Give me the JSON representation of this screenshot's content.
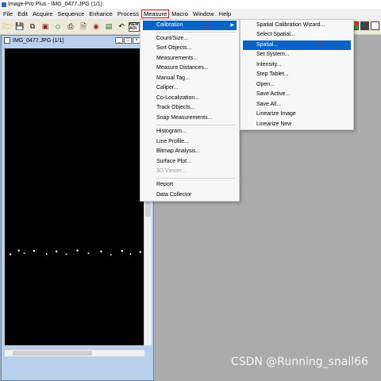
{
  "window": {
    "title": "Image-Pro Plus - IMG_0477.JPG (1/1)"
  },
  "menubar": {
    "items": [
      "File",
      "Edit",
      "Acquire",
      "Sequence",
      "Enhance",
      "Process",
      "Measure",
      "Macro",
      "Window",
      "Help"
    ],
    "active": "Measure"
  },
  "toolbar": {
    "icons": [
      "open-folder-icon",
      "save-icon",
      "copy-icon",
      "stamp-icon",
      "lasso-icon",
      "print-icon",
      "preview-icon",
      "color-icon",
      "image-icon",
      "undo-icon",
      "new-aoi-icon",
      "mesh-icon"
    ],
    "new_aoi_label": "NEW AOI"
  },
  "document": {
    "title": "IMG_0477.JPG (1/1)"
  },
  "measure_menu": {
    "items": [
      {
        "label": "Calibration",
        "highlighted": true,
        "submenu": true
      },
      {
        "label": "Count/Size..."
      },
      {
        "label": "Sort Objects..."
      },
      {
        "label": "Measurements..."
      },
      {
        "label": "Measure Distances..."
      },
      {
        "label": "Manual Tag..."
      },
      {
        "label": "Caliper..."
      },
      {
        "label": "Co-Localization..."
      },
      {
        "label": "Track Objects..."
      },
      {
        "label": "Snap Measurements..."
      },
      {
        "label": "Histogram..."
      },
      {
        "label": "Line Profile..."
      },
      {
        "label": "Bitmap Analysis..."
      },
      {
        "label": "Surface Plot..."
      },
      {
        "label": "3D Viewer...",
        "disabled": true
      },
      {
        "label": "Report"
      },
      {
        "label": "Data Collector"
      }
    ]
  },
  "calibration_submenu": {
    "items": [
      {
        "label": "Spatial Calibration Wizard..."
      },
      {
        "label": "Select Spatial..."
      },
      {
        "label": "Spatial...",
        "highlighted": true
      },
      {
        "label": "Set System..."
      },
      {
        "label": "Intensity..."
      },
      {
        "label": "Step Tablet..."
      },
      {
        "label": "Open..."
      },
      {
        "label": "Save Active..."
      },
      {
        "label": "Save All..."
      },
      {
        "label": "Linearize Image"
      },
      {
        "label": "Linearize New"
      }
    ]
  },
  "annotation": {
    "mark": "✓"
  },
  "watermark": "CSDN @Running_snail66",
  "colors": {
    "highlight": "#0a64c8",
    "annotation": "#d21b1b",
    "workspace": "#ababab"
  }
}
